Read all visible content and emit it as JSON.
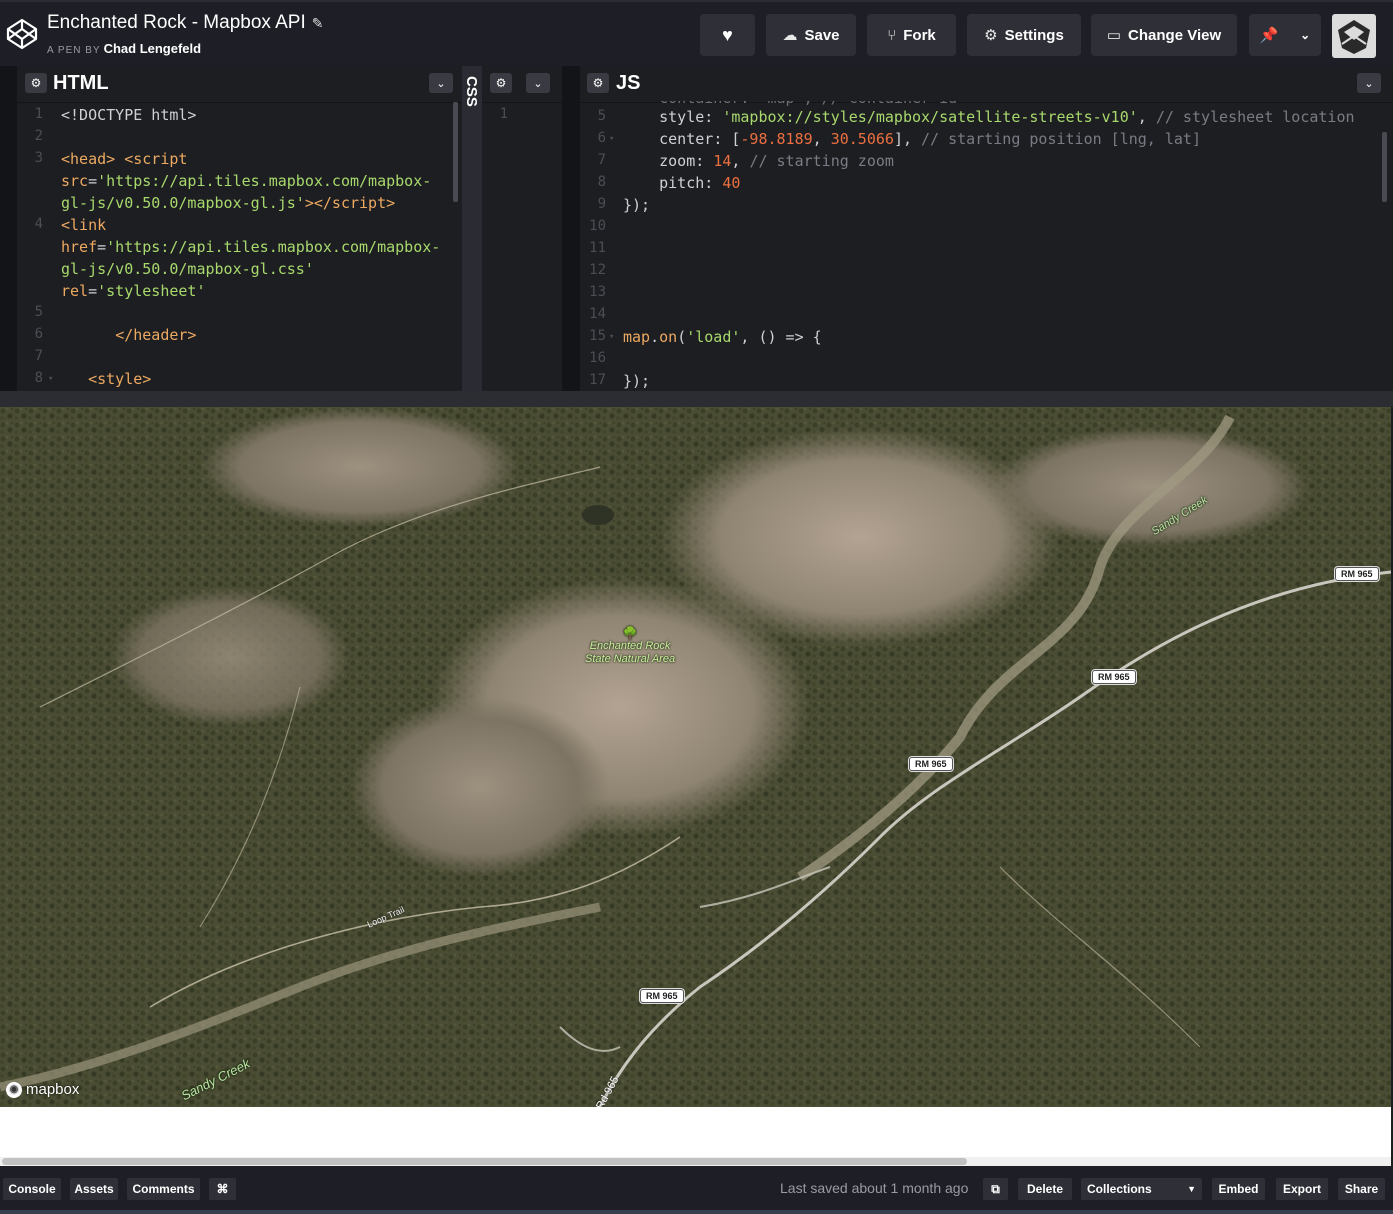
{
  "header": {
    "title": "Enchanted Rock - Mapbox API",
    "by_label": "A PEN BY",
    "author": "Chad Lengefeld",
    "buttons": {
      "save": "Save",
      "fork": "Fork",
      "settings": "Settings",
      "change_view": "Change View"
    }
  },
  "editors": {
    "html": {
      "title": "HTML",
      "line_numbers": [
        "1",
        "2",
        "3",
        "",
        "",
        "4",
        "",
        "",
        "5",
        "6",
        "7",
        "8"
      ]
    },
    "css": {
      "title": "CSS",
      "line_numbers": [
        "1"
      ]
    },
    "js": {
      "title": "JS",
      "line_numbers": [
        "5",
        "6",
        "7",
        "8",
        "9",
        "10",
        "11",
        "12",
        "13",
        "14",
        "15",
        "16",
        "17"
      ]
    }
  },
  "map": {
    "park_label_1": "Enchanted Rock",
    "park_label_2": "State Natural Area",
    "creek_north": "Sandy Creek",
    "creek_south": "Sandy Creek",
    "loop_trail": "Loop Trail",
    "road_shields": [
      "RM 965",
      "RM 965",
      "RM 965",
      "RM 965"
    ],
    "road_bottom": "Rd 965",
    "attribution": "mapbox"
  },
  "footer": {
    "console": "Console",
    "assets": "Assets",
    "comments": "Comments",
    "shortcuts": "⌘",
    "last_saved": "Last saved about 1 month ago",
    "delete": "Delete",
    "collections": "Collections",
    "embed": "Embed",
    "export": "Export",
    "share": "Share"
  },
  "colors": {
    "header_bg": "#1e1f26",
    "editor_bg": "#1d1e22",
    "button_bg": "#2f3037",
    "string": "#a8d96c",
    "tag": "#eca961",
    "number": "#eb6f40",
    "comment": "#7a7b84"
  }
}
